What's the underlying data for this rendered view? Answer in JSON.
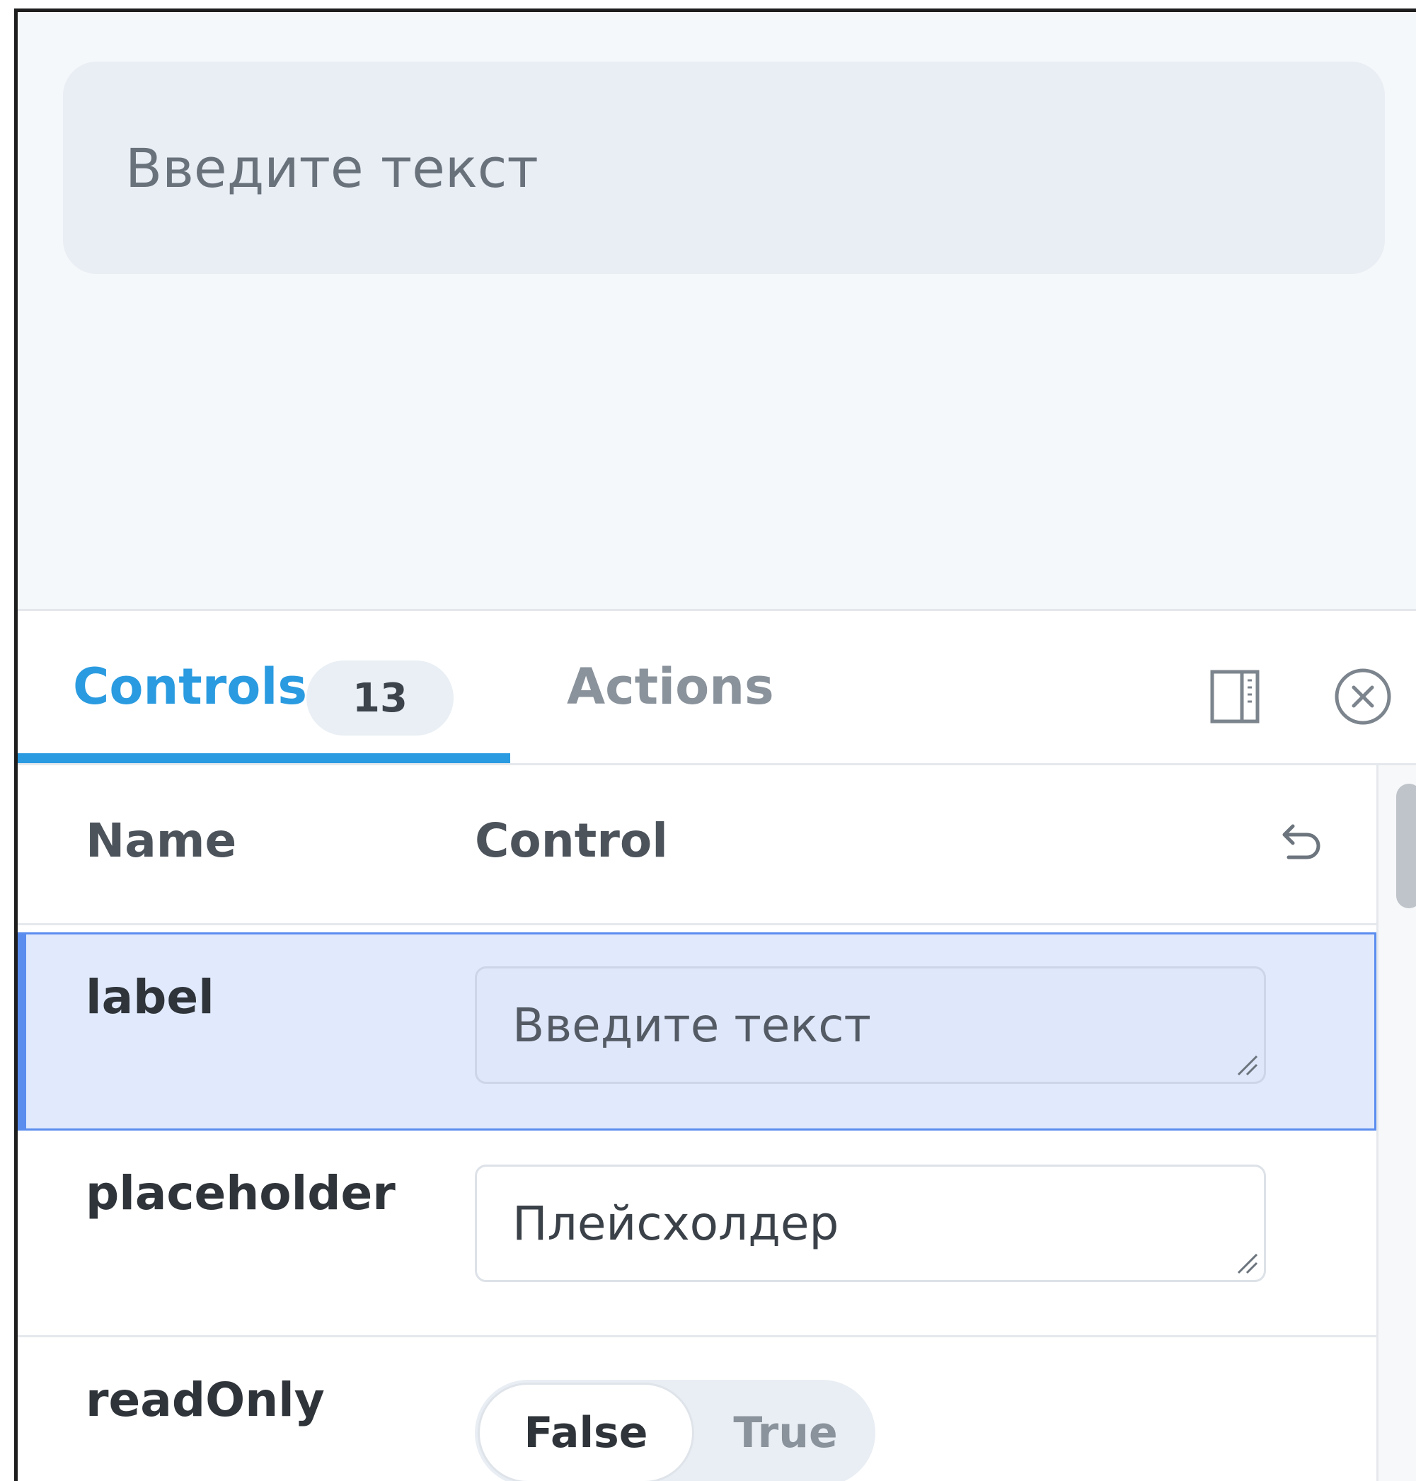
{
  "preview": {
    "input_text": "Введите текст"
  },
  "tabs": {
    "controls_label": "Controls",
    "controls_count": "13",
    "actions_label": "Actions"
  },
  "table": {
    "header_name": "Name",
    "header_control": "Control",
    "rows": [
      {
        "name": "label",
        "value": "Введите текст"
      },
      {
        "name": "placeholder",
        "value": "Плейсхолдер"
      },
      {
        "name": "readOnly",
        "options": [
          "False",
          "True"
        ],
        "selected": "False"
      }
    ]
  },
  "icons": {
    "panel": "panel-toggle-icon",
    "close": "close-icon",
    "reset": "undo-icon"
  },
  "colors": {
    "accent": "#2a9be0",
    "active_row_bg": "#e1eafc",
    "active_row_border": "#5b8def"
  }
}
